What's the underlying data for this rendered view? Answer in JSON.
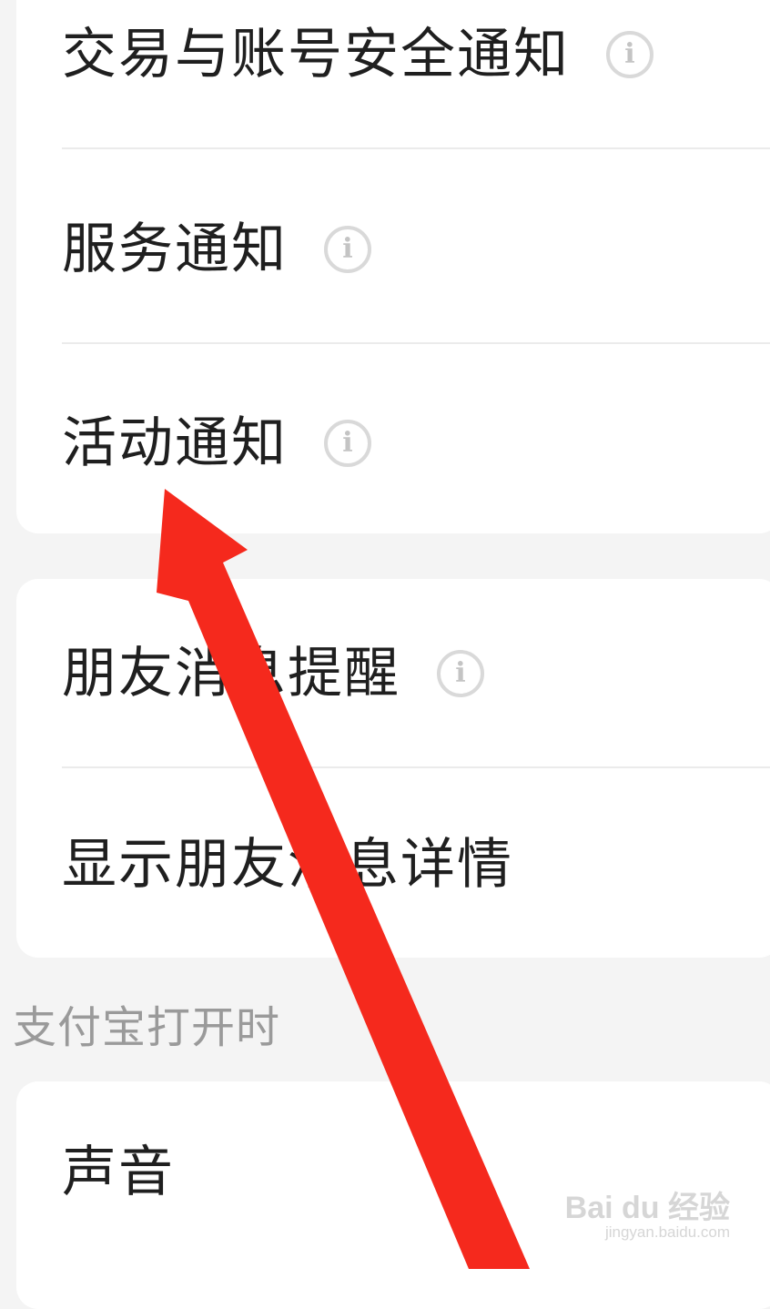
{
  "groups": {
    "first": {
      "items": [
        {
          "label": "交易与账号安全通知"
        },
        {
          "label": "服务通知"
        },
        {
          "label": "活动通知"
        }
      ]
    },
    "second": {
      "items": [
        {
          "label": "朋友消息提醒"
        },
        {
          "label": "显示朋友消息详情"
        }
      ]
    },
    "third": {
      "title": "支付宝打开时",
      "items": [
        {
          "label": "声音"
        }
      ]
    }
  },
  "info_glyph": "i",
  "annotation_arrow_color": "#f5291d",
  "watermark": {
    "brand": "Bai du 经验",
    "url": "jingyan.baidu.com"
  }
}
